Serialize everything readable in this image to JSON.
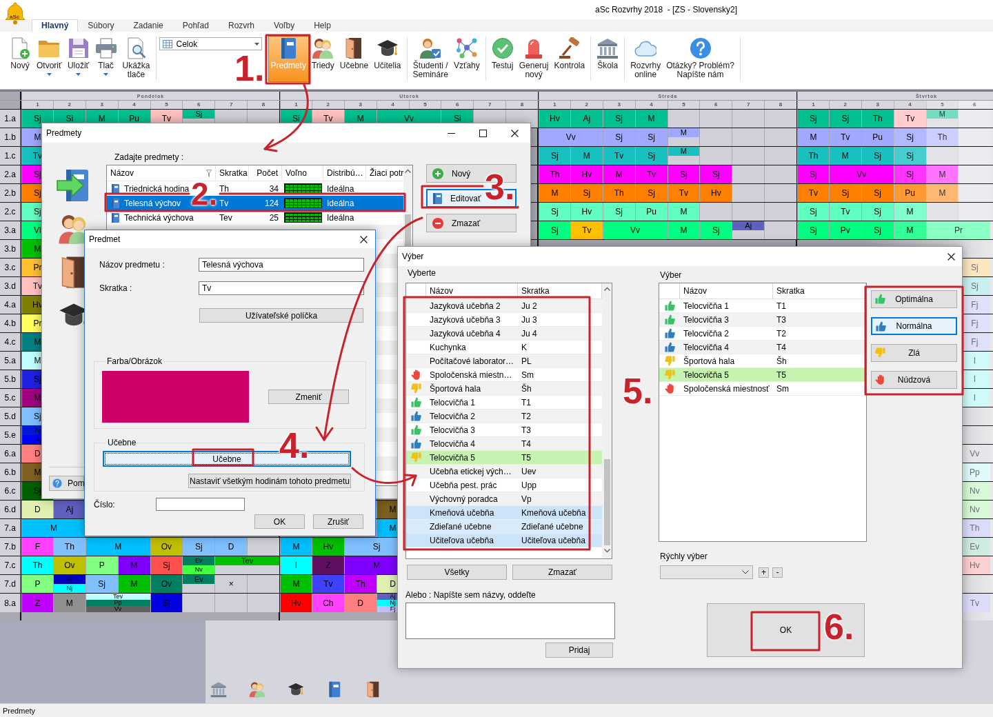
{
  "window": {
    "title": "aSc Rozvrhy 2018  - [ZS - Slovensky2]",
    "logo_text": "aSc"
  },
  "ribbon_tabs": [
    {
      "label": "Hlavný",
      "selected": true
    },
    {
      "label": "Súbory",
      "selected": false
    },
    {
      "label": "Zadanie",
      "selected": false
    },
    {
      "label": "Pohľad",
      "selected": false
    },
    {
      "label": "Rozvrh",
      "selected": false
    },
    {
      "label": "Voľby",
      "selected": false
    },
    {
      "label": "Help",
      "selected": false
    }
  ],
  "toolbar": {
    "groups": [
      {
        "kind": "buttons",
        "buttons": [
          {
            "label": "Nový",
            "dropdown": false,
            "selected": false
          },
          {
            "label": "Otvoriť",
            "dropdown": true,
            "selected": false
          },
          {
            "label": "Uložiť",
            "dropdown": true,
            "selected": false
          },
          {
            "label": "Tlač",
            "dropdown": true,
            "selected": false
          },
          {
            "label": "Ukážka\ntlače",
            "dropdown": false,
            "selected": false
          }
        ]
      },
      {
        "kind": "combo",
        "value": "Celok"
      },
      {
        "kind": "buttons",
        "buttons": [
          {
            "label": "Predmety",
            "dropdown": false,
            "selected": true
          },
          {
            "label": "Triedy",
            "dropdown": false,
            "selected": false
          },
          {
            "label": "Učebne",
            "dropdown": false,
            "selected": false
          },
          {
            "label": "Učitelia",
            "dropdown": false,
            "selected": false
          }
        ]
      },
      {
        "kind": "buttons",
        "buttons": [
          {
            "label": "Študenti /\nSemináre",
            "dropdown": false,
            "selected": false
          },
          {
            "label": "Vzťahy",
            "dropdown": false,
            "selected": false
          }
        ]
      },
      {
        "kind": "buttons",
        "buttons": [
          {
            "label": "Testuj",
            "dropdown": false,
            "selected": false
          },
          {
            "label": "Generuj\nnový",
            "dropdown": false,
            "selected": false
          },
          {
            "label": "Kontrola",
            "dropdown": false,
            "selected": false
          }
        ]
      },
      {
        "kind": "buttons",
        "buttons": [
          {
            "label": "Škola",
            "dropdown": false,
            "selected": false
          }
        ]
      },
      {
        "kind": "buttons",
        "buttons": [
          {
            "label": "Rozvrhy\nonline",
            "dropdown": false,
            "selected": false
          },
          {
            "label": "Otázky? Problém?\nNapíšte nám",
            "dropdown": false,
            "selected": false
          }
        ]
      }
    ]
  },
  "timetable": {
    "days": [
      {
        "name": "Pondelok",
        "periods": [
          "1",
          "2",
          "3",
          "4",
          "5",
          "6",
          "7",
          "8"
        ]
      },
      {
        "name": "Utorok",
        "periods": [
          "1",
          "2",
          "3",
          "4",
          "5",
          "6",
          "7",
          "8"
        ]
      },
      {
        "name": "Streda",
        "periods": [
          "1",
          "2",
          "3",
          "4",
          "5",
          "6",
          "7",
          "8"
        ]
      },
      {
        "name": "Štvrtok",
        "periods": [
          "1",
          "2",
          "3",
          "4",
          "5",
          "6"
        ]
      }
    ],
    "rows": [
      {
        "label": "1.a",
        "mon": [
          {
            "kind": "one",
            "text": "Sj",
            "color": "#00c090"
          },
          {
            "kind": "one",
            "text": "Si",
            "color": "#00c090"
          },
          {
            "kind": "one",
            "text": "M",
            "color": "#00c090"
          },
          {
            "kind": "one",
            "text": "Pu",
            "color": "#00c090"
          },
          {
            "kind": "one",
            "text": "Tv",
            "color": "#ffc0c0"
          },
          {
            "kind": "half",
            "text": "Sj",
            "color": "#00c090"
          },
          {
            "kind": "free"
          },
          {
            "kind": "free"
          }
        ],
        "tue": [
          {
            "kind": "one",
            "text": "Si",
            "color": "#00c090"
          },
          {
            "kind": "one",
            "text": "Tv",
            "color": "#ffc0c0"
          },
          {
            "kind": "one",
            "text": "M",
            "color": "#00c090"
          },
          {
            "kind": "two",
            "text": "Vv",
            "color": "#00c090"
          },
          {
            "kind": "one",
            "text": "Si",
            "color": "#00c090"
          },
          {
            "kind": "free"
          },
          {
            "kind": "free"
          }
        ],
        "wed": [
          {
            "kind": "one",
            "text": "Hv",
            "color": "#00c090"
          },
          {
            "kind": "one",
            "text": "Aj",
            "color": "#00c090"
          },
          {
            "kind": "one",
            "text": "Sj",
            "color": "#00c090"
          },
          {
            "kind": "one",
            "text": "M",
            "color": "#00c090"
          },
          {
            "kind": "free"
          },
          {
            "kind": "free"
          },
          {
            "kind": "free"
          },
          {
            "kind": "free"
          }
        ],
        "thu": [
          {
            "kind": "one",
            "text": "Sj",
            "color": "#00c090"
          },
          {
            "kind": "one",
            "text": "Sj",
            "color": "#00c090"
          },
          {
            "kind": "one",
            "text": "Th",
            "color": "#00c090"
          },
          {
            "kind": "one",
            "text": "Tv",
            "color": "#ffcdcd"
          },
          {
            "kind": "half",
            "text": "M",
            "color": "#73dcc2"
          },
          {
            "kind": "free"
          }
        ]
      },
      {
        "label": "1.b",
        "mon": [
          {
            "kind": "one",
            "text": "M",
            "color": "#a0a8ff"
          }
        ],
        "wed": [
          {
            "kind": "two",
            "text": "Vv",
            "color": "#a0a8ff"
          },
          {
            "kind": "one",
            "text": "Sj",
            "color": "#a0a8ff"
          },
          {
            "kind": "one",
            "text": "Sj",
            "color": "#a0a8ff"
          },
          {
            "kind": "half",
            "text": "M",
            "color": "#a0a8ff"
          },
          {
            "kind": "free"
          },
          {
            "kind": "free"
          },
          {
            "kind": "free"
          }
        ],
        "thu": [
          {
            "kind": "one",
            "text": "M",
            "color": "#a0a8ff"
          },
          {
            "kind": "one",
            "text": "Tv",
            "color": "#a0a8ff"
          },
          {
            "kind": "one",
            "text": "Pu",
            "color": "#a0a8ff"
          },
          {
            "kind": "one",
            "text": "Sj",
            "color": "#b3b9ff"
          },
          {
            "kind": "one",
            "text": "Th",
            "color": "#cbcfff"
          },
          {
            "kind": "free"
          }
        ]
      },
      {
        "label": "1.c",
        "mon": [
          {
            "kind": "one",
            "text": "Tv",
            "color": "#18c0c0"
          }
        ],
        "wed": [
          {
            "kind": "one",
            "text": "Sj",
            "color": "#18c0c0"
          },
          {
            "kind": "one",
            "text": "M",
            "color": "#18c0c0"
          },
          {
            "kind": "one",
            "text": "Tv",
            "color": "#18c0c0"
          },
          {
            "kind": "one",
            "text": "Sj",
            "color": "#18c0c0"
          },
          {
            "kind": "half",
            "text": "M",
            "color": "#18c0c0"
          },
          {
            "kind": "free"
          },
          {
            "kind": "free"
          },
          {
            "kind": "free"
          }
        ],
        "thu": [
          {
            "kind": "one",
            "text": "Th",
            "color": "#18c0c0"
          },
          {
            "kind": "one",
            "text": "M",
            "color": "#18c0c0"
          },
          {
            "kind": "one",
            "text": "Sj",
            "color": "#18c0c0"
          },
          {
            "kind": "one",
            "text": "Sj",
            "color": "#46cdcd"
          },
          {
            "kind": "free"
          },
          {
            "kind": "free"
          }
        ]
      },
      {
        "label": "2.a",
        "mon": [
          {
            "kind": "one",
            "text": "Sj",
            "color": "#ff00ff"
          }
        ],
        "wed": [
          {
            "kind": "one",
            "text": "Th",
            "color": "#ff00ff"
          },
          {
            "kind": "one",
            "text": "Hv",
            "color": "#ff00ff"
          },
          {
            "kind": "one",
            "text": "M",
            "color": "#ff00ff"
          },
          {
            "kind": "one",
            "text": "Tv",
            "color": "#ff00ff"
          },
          {
            "kind": "one",
            "text": "Sj",
            "color": "#ff00ff"
          },
          {
            "kind": "one",
            "text": "Sj",
            "color": "#ff00ff"
          },
          {
            "kind": "free"
          },
          {
            "kind": "free"
          }
        ],
        "thu": [
          {
            "kind": "one",
            "text": "Sj",
            "color": "#ff00ff"
          },
          {
            "kind": "two",
            "text": "Vv",
            "color": "#ff00ff"
          },
          {
            "kind": "one",
            "text": "Sj",
            "color": "#ff33ff"
          },
          {
            "kind": "one",
            "text": "M",
            "color": "#ff73ff"
          },
          {
            "kind": "free"
          }
        ]
      },
      {
        "label": "2.b",
        "mon": [
          {
            "kind": "one",
            "text": "Sj",
            "color": "#ff8000"
          }
        ],
        "wed": [
          {
            "kind": "one",
            "text": "M",
            "color": "#ff8000"
          },
          {
            "kind": "one",
            "text": "Sj",
            "color": "#ff8000"
          },
          {
            "kind": "one",
            "text": "Th",
            "color": "#ff8000"
          },
          {
            "kind": "one",
            "text": "Sj",
            "color": "#ff8000"
          },
          {
            "kind": "one",
            "text": "Tv",
            "color": "#ff8000"
          },
          {
            "kind": "one",
            "text": "Hv",
            "color": "#ff8000"
          },
          {
            "kind": "free"
          },
          {
            "kind": "free"
          }
        ],
        "thu": [
          {
            "kind": "one",
            "text": "Tv",
            "color": "#ff8000"
          },
          {
            "kind": "one",
            "text": "Sj",
            "color": "#ff8000"
          },
          {
            "kind": "one",
            "text": "Sj",
            "color": "#ff8000"
          },
          {
            "kind": "one",
            "text": "Pu",
            "color": "#ff9933"
          },
          {
            "kind": "one",
            "text": "M",
            "color": "#ffb973"
          },
          {
            "kind": "free"
          }
        ]
      },
      {
        "label": "2.c",
        "mon": [
          {
            "kind": "one",
            "text": "Sj",
            "color": "#60ffc0"
          }
        ],
        "wed": [
          {
            "kind": "one",
            "text": "Sj",
            "color": "#60ffc0"
          },
          {
            "kind": "one",
            "text": "Hv",
            "color": "#60ffc0"
          },
          {
            "kind": "one",
            "text": "Sj",
            "color": "#60ffc0"
          },
          {
            "kind": "one",
            "text": "Pu",
            "color": "#60ffc0"
          },
          {
            "kind": "one",
            "text": "M",
            "color": "#60ffc0"
          },
          {
            "kind": "free"
          },
          {
            "kind": "free"
          },
          {
            "kind": "free"
          }
        ],
        "thu": [
          {
            "kind": "one",
            "text": "Sj",
            "color": "#60ffc0"
          },
          {
            "kind": "one",
            "text": "Tv",
            "color": "#60ffc0"
          },
          {
            "kind": "one",
            "text": "Sj",
            "color": "#60ffc0"
          },
          {
            "kind": "one",
            "text": "M",
            "color": "#80ffcd"
          },
          {
            "kind": "free"
          },
          {
            "kind": "free"
          }
        ]
      },
      {
        "label": "3.a",
        "mon": [
          {
            "kind": "one",
            "text": "Vl",
            "color": "#00ff80"
          }
        ],
        "wed": [
          {
            "kind": "one",
            "text": "Sj",
            "color": "#00ff80"
          },
          {
            "kind": "one",
            "text": "Tv",
            "color": "#ffc000"
          },
          {
            "kind": "two",
            "text": "Vv",
            "color": "#00ff80"
          },
          {
            "kind": "one",
            "text": "M",
            "color": "#00ff80"
          },
          {
            "kind": "one",
            "text": "Sj",
            "color": "#00ff80"
          },
          {
            "kind": "half",
            "text": "Aj",
            "color": "#6060c0"
          },
          {
            "kind": "free"
          }
        ],
        "thu": [
          {
            "kind": "one",
            "text": "Sj",
            "color": "#00ff80"
          },
          {
            "kind": "one",
            "text": "Pv",
            "color": "#00ff80"
          },
          {
            "kind": "one",
            "text": "Sj",
            "color": "#00ff80"
          },
          {
            "kind": "one",
            "text": "M",
            "color": "#33ff99"
          },
          {
            "kind": "two",
            "text": "Pr",
            "color": "#8cffc6"
          }
        ]
      },
      {
        "label": "3.b",
        "mon": [
          {
            "kind": "one",
            "text": "M",
            "color": "#00c000"
          }
        ]
      },
      {
        "label": "3.c",
        "mon": [
          {
            "kind": "one",
            "text": "Pr",
            "color": "#ffc030"
          }
        ],
        "thu_end": {
          "kind": "one",
          "text": "Sj",
          "color": "#fbe6c0"
        }
      },
      {
        "label": "3.d",
        "mon": [
          {
            "kind": "one",
            "text": "Tv",
            "color": "#ffc0c0"
          }
        ],
        "thu_end": {
          "kind": "one",
          "text": "Sj",
          "color": "#c8f0f0"
        }
      },
      {
        "label": "4.a",
        "mon": [
          {
            "kind": "one",
            "text": "Hv",
            "color": "#808000"
          }
        ],
        "thu_end": {
          "kind": "one",
          "text": "Fj",
          "color": "#e0e0fa"
        }
      },
      {
        "label": "4.b",
        "mon": [
          {
            "kind": "one",
            "text": "Pr",
            "color": "#ffff60"
          }
        ],
        "thu_end": {
          "kind": "one",
          "text": "Fj",
          "color": "#e0e0fa"
        }
      },
      {
        "label": "4.c",
        "mon": [
          {
            "kind": "one",
            "text": "M",
            "color": "#008080"
          }
        ],
        "thu_end": {
          "kind": "one",
          "text": "Fj",
          "color": "#e0e0fa"
        }
      },
      {
        "label": "5.a",
        "mon": [
          {
            "kind": "one",
            "text": "M",
            "color": "#c0ffff"
          }
        ],
        "thu_end": {
          "kind": "one",
          "text": "I",
          "color": "#d0fafa"
        }
      },
      {
        "label": "5.b",
        "mon": [
          {
            "kind": "one",
            "text": "Sj",
            "color": "#2020e0"
          }
        ],
        "thu_end": {
          "kind": "one",
          "text": "I",
          "color": "#d0fafa"
        }
      },
      {
        "label": "5.c",
        "mon": [
          {
            "kind": "one",
            "text": "M",
            "color": "#a00080"
          }
        ],
        "thu_end": {
          "kind": "one",
          "text": "I",
          "color": "#d0fafa"
        }
      },
      {
        "label": "5.d",
        "mon": [
          {
            "kind": "one",
            "text": "Sj",
            "color": "#80c0ff"
          }
        ]
      },
      {
        "label": "5.e",
        "mon": [
          {
            "kind": "stack",
            "parts": [
              {
                "text": "Aj",
                "color": "#0018d8"
              },
              {
                "text": "Nj",
                "color": "#0000ff"
              }
            ]
          }
        ]
      },
      {
        "label": "6.a",
        "mon": [
          {
            "kind": "one",
            "text": "D",
            "color": "#ff8080"
          }
        ],
        "thu_end": {
          "kind": "one",
          "text": "Vv",
          "color": "#e6e6ea"
        }
      },
      {
        "label": "6.b",
        "mon": [
          {
            "kind": "one",
            "text": "M",
            "color": "#806020"
          }
        ],
        "thu_end": {
          "kind": "one",
          "text": "Pp",
          "color": "#e0fafa"
        }
      },
      {
        "label": "6.c",
        "mon": [
          {
            "kind": "one",
            "text": "Sj",
            "color": "#006000"
          }
        ],
        "thu_end": {
          "kind": "one",
          "text": "Nv",
          "color": "#d8fad8"
        }
      },
      {
        "label": "6.d",
        "mon": [
          {
            "kind": "one",
            "text": "D",
            "color": "#e0f0b0"
          },
          {
            "kind": "one",
            "text": "Aj",
            "color": "#6060c0"
          }
        ],
        "tue_end": {
          "kind": "one",
          "text": "M",
          "color": "#806020"
        },
        "thu_end": {
          "kind": "one",
          "text": "Nv",
          "color": "#d8fad8"
        }
      },
      {
        "label": "7.a",
        "mon": [
          {
            "kind": "two",
            "text": "M",
            "color": "#00c0ff"
          }
        ],
        "tue_end": {
          "kind": "one",
          "text": "M",
          "color": "#00c0ff"
        },
        "thu_end": {
          "kind": "one",
          "text": "Th",
          "color": "#dcdcfa"
        }
      },
      {
        "label": "7.b",
        "mon": [
          {
            "kind": "one",
            "text": "F",
            "color": "#ff40ff"
          },
          {
            "kind": "one",
            "text": "Th",
            "color": "#80c0ff"
          },
          {
            "kind": "two",
            "text": "M",
            "color": "#00c0ff"
          },
          {
            "kind": "one",
            "text": "Ov",
            "color": "#c0c000"
          },
          {
            "kind": "one",
            "text": "Sj",
            "color": "#80c0ff"
          },
          {
            "kind": "one",
            "text": "D",
            "color": "#80c0ff"
          },
          {
            "kind": "free"
          }
        ],
        "tue": [
          {
            "kind": "one",
            "text": "M",
            "color": "#00c0ff"
          },
          {
            "kind": "one",
            "text": "Hv",
            "color": "#00c000"
          },
          {
            "kind": "two",
            "text": "Sj",
            "color": "#80c0ff"
          }
        ],
        "thu_end": {
          "kind": "one",
          "text": "Ev",
          "color": "#d0ece0"
        }
      },
      {
        "label": "7.c",
        "mon": [
          {
            "kind": "one",
            "text": "Th",
            "color": "#00ffff"
          },
          {
            "kind": "one",
            "text": "Ov",
            "color": "#c0c000"
          },
          {
            "kind": "one",
            "text": "P",
            "color": "#80ff80"
          },
          {
            "kind": "one",
            "text": "M",
            "color": "#8000ff"
          },
          {
            "kind": "one",
            "text": "Sj",
            "color": "#ff5050"
          },
          {
            "kind": "stack",
            "parts": [
              {
                "text": "Ev",
                "color": "#008060"
              },
              {
                "text": "Nv",
                "color": "#40ff40"
              }
            ]
          },
          {
            "kind": "wide_half",
            "text": "Tev",
            "color": "#00c000"
          }
        ],
        "tue": [
          {
            "kind": "one",
            "text": "I",
            "color": "#00ffff"
          },
          {
            "kind": "one",
            "text": "Z",
            "color": "#601060"
          },
          {
            "kind": "two",
            "text": "M",
            "color": "#8000ff"
          }
        ],
        "thu_end": {
          "kind": "one",
          "text": "Hv",
          "color": "#fad0d0"
        }
      },
      {
        "label": "7.d",
        "mon": [
          {
            "kind": "one",
            "text": "P",
            "color": "#80ff80"
          },
          {
            "kind": "stack",
            "parts": [
              {
                "text": "Aj",
                "color": "#0000c0"
              },
              {
                "text": "Nj",
                "color": "#00ffff"
              }
            ]
          },
          {
            "kind": "one",
            "text": "Sj",
            "color": "#80c0ff"
          },
          {
            "kind": "one",
            "text": "M",
            "color": "#00c000"
          },
          {
            "kind": "one",
            "text": "Ov",
            "color": "#008060"
          },
          {
            "kind": "half",
            "text": "Ev",
            "color": "#008060"
          },
          {
            "kind": "one",
            "text": "×",
            "color": "#d0d0d8"
          },
          {
            "kind": "free"
          }
        ],
        "tue": [
          {
            "kind": "one",
            "text": "M",
            "color": "#00c000"
          },
          {
            "kind": "one",
            "text": "Tv",
            "color": "#4040ff"
          },
          {
            "kind": "one",
            "text": "Th",
            "color": "#c000ff"
          },
          {
            "kind": "one",
            "text": "D",
            "color": "#e0f0b0"
          }
        ]
      },
      {
        "label": "8.a",
        "mon": [
          {
            "kind": "one",
            "text": "Z",
            "color": "#c000ff"
          },
          {
            "kind": "one",
            "text": "M",
            "color": "#909090"
          },
          {
            "kind": "wide_stack",
            "parts": [
              {
                "text": "Tev",
                "color": "#c0ffff"
              },
              {
                "text": "Pp",
                "color": "#008060"
              },
              {
                "text": "Vv",
                "color": "#606060"
              }
            ]
          },
          {
            "kind": "one",
            "text": "Sj",
            "color": "#0000e0"
          },
          {
            "kind": "free"
          },
          {
            "kind": "free"
          },
          {
            "kind": "free"
          }
        ],
        "tue": [
          {
            "kind": "one",
            "text": "Hv",
            "color": "#ff0000"
          },
          {
            "kind": "one",
            "text": "Ch",
            "color": "#ff40ff"
          },
          {
            "kind": "one",
            "text": "D",
            "color": "#ff8080"
          },
          {
            "kind": "stack",
            "parts": [
              {
                "text": "Aj",
                "color": "#6060c0"
              },
              {
                "text": "Nj",
                "color": "#00ffff"
              },
              {
                "text": "Fj",
                "color": "#c0c0ff"
              }
            ]
          }
        ],
        "thu_end": {
          "kind": "one",
          "text": "Tv",
          "color": "#dcdcfa"
        }
      }
    ]
  },
  "predmety_dialog": {
    "title": "Predmety",
    "prompt": "Zadajte predmety :",
    "columns": [
      "Názov",
      "Skratka",
      "Počet",
      "Voľno",
      "Distribú…",
      "Žiaci potr"
    ],
    "rows": [
      {
        "name": "Triednická hodina",
        "short": "Th",
        "count": "34",
        "distribution": "Ideálna",
        "selected": false
      },
      {
        "name": "Telesná výchov",
        "short": "Tv",
        "count": "124",
        "distribution": "Ideálna",
        "selected": true
      },
      {
        "name": "Technická výchova",
        "short": "Tev",
        "count": "25",
        "distribution": "Ideálna",
        "selected": false
      }
    ],
    "buttons": [
      {
        "label": "Nový",
        "kind": "add",
        "focused": false
      },
      {
        "label": "Editovať",
        "kind": "edit",
        "focused": true
      },
      {
        "label": "Zmazať",
        "kind": "delete",
        "focused": false
      }
    ],
    "help_button": "Pom"
  },
  "predmet_dialog": {
    "title": "Predmet",
    "fields": [
      {
        "label": "Názov predmetu :",
        "value": "Telesná výchova"
      },
      {
        "label": "Skratka :",
        "value": "Tv"
      }
    ],
    "custom_fields_button": "Užívateľské políčka",
    "color_group": {
      "legend": "Farba/Obrázok",
      "color": "#cc0066",
      "change_button": "Zmeniť"
    },
    "rooms_group": {
      "legend": "Učebne",
      "rooms_button": {
        "label": "Učebne",
        "focused": true
      },
      "apply_button": "Nastaviť všetkým hodinám tohoto predmetu"
    },
    "number_field": {
      "label": "Číslo:"
    },
    "buttons": [
      "OK",
      "Zrušiť"
    ]
  },
  "vyber_dialog": {
    "title": "Výber",
    "available": {
      "label": "Vyberte",
      "columns": [
        "Názov",
        "Skratka"
      ],
      "items": [
        {
          "name": "Jazyková učebňa 2",
          "short": "Ju 2",
          "kind": "plain",
          "selected": false
        },
        {
          "name": "Jazyková učebňa 3",
          "short": "Ju 3",
          "kind": "plain",
          "selected": false
        },
        {
          "name": "Jazyková učebňa 4",
          "short": "Ju 4",
          "kind": "plain",
          "selected": false
        },
        {
          "name": "Kuchynka",
          "short": "K",
          "kind": "plain",
          "selected": false
        },
        {
          "name": "Počítačové laborator…",
          "short": "PL",
          "kind": "plain",
          "selected": false
        },
        {
          "name": "Spoločenská miestn…",
          "short": "Sm",
          "kind": "emergency",
          "selected": false
        },
        {
          "name": "Športová hala",
          "short": "Šh",
          "kind": "bad",
          "selected": false
        },
        {
          "name": "Telocvičňa 1",
          "short": "T1",
          "kind": "optimal",
          "selected": false
        },
        {
          "name": "Telocvičňa 2",
          "short": "T2",
          "kind": "normal",
          "selected": false
        },
        {
          "name": "Telocvičňa 3",
          "short": "T3",
          "kind": "optimal",
          "selected": false
        },
        {
          "name": "Telocvičňa 4",
          "short": "T4",
          "kind": "normal",
          "selected": false
        },
        {
          "name": "Telocvičňa 5",
          "short": "T5",
          "kind": "bad",
          "selected": true
        },
        {
          "name": "Učebňa etickej vých…",
          "short": "Uev",
          "kind": "plain",
          "selected": false
        },
        {
          "name": "Učebňa pest. prác",
          "short": "Upp",
          "kind": "plain",
          "selected": false
        },
        {
          "name": "Výchovný poradca",
          "short": "Vp",
          "kind": "plain",
          "selected": false
        },
        {
          "name": "Kmeňová učebňa",
          "short": "Kmeňová učebňa",
          "kind": "group",
          "selected": false
        },
        {
          "name": "Zdieľané učebne",
          "short": "Zdieľané učebne",
          "kind": "group",
          "selected": false
        },
        {
          "name": "Učiteľova učebňa",
          "short": "Učiteľova učebňa",
          "kind": "group",
          "selected": false
        }
      ]
    },
    "available_buttons": [
      "Všetky",
      "Zmazať"
    ],
    "names_label": "Alebo : Napíšte sem názvy, oddeľte",
    "add_button": "Pridaj",
    "chosen": {
      "label": "Výber",
      "columns": [
        "Názov",
        "Skratka"
      ],
      "items": [
        {
          "name": "Telocvičňa 1",
          "short": "T1",
          "kind": "optimal",
          "selected": false
        },
        {
          "name": "Telocvičňa 3",
          "short": "T3",
          "kind": "optimal",
          "selected": false
        },
        {
          "name": "Telocvičňa 2",
          "short": "T2",
          "kind": "normal",
          "selected": false
        },
        {
          "name": "Telocvičňa 4",
          "short": "T4",
          "kind": "normal",
          "selected": false
        },
        {
          "name": "Športová hala",
          "short": "Šh",
          "kind": "bad",
          "selected": false
        },
        {
          "name": "Telocvičňa 5",
          "short": "T5",
          "kind": "bad",
          "selected": true
        },
        {
          "name": "Spoločenská miestnosť",
          "short": "Sm",
          "kind": "emergency",
          "selected": false
        }
      ]
    },
    "rating_buttons": [
      {
        "label": "Optimálna",
        "kind": "optimal",
        "focused": false
      },
      {
        "label": "Normálna",
        "kind": "normal",
        "focused": true
      },
      {
        "label": "Zlá",
        "kind": "bad",
        "focused": false
      },
      {
        "label": "Núdzová",
        "kind": "emergency",
        "focused": false
      }
    ],
    "quick_select": {
      "label": "Rýchly výber",
      "add": "+",
      "remove": "-"
    },
    "ok_button": "OK"
  },
  "status_bar": {
    "text": "Predmety"
  },
  "annotations": {
    "steps": [
      "1.",
      "2.",
      "3.",
      "4.",
      "5.",
      "6."
    ]
  }
}
